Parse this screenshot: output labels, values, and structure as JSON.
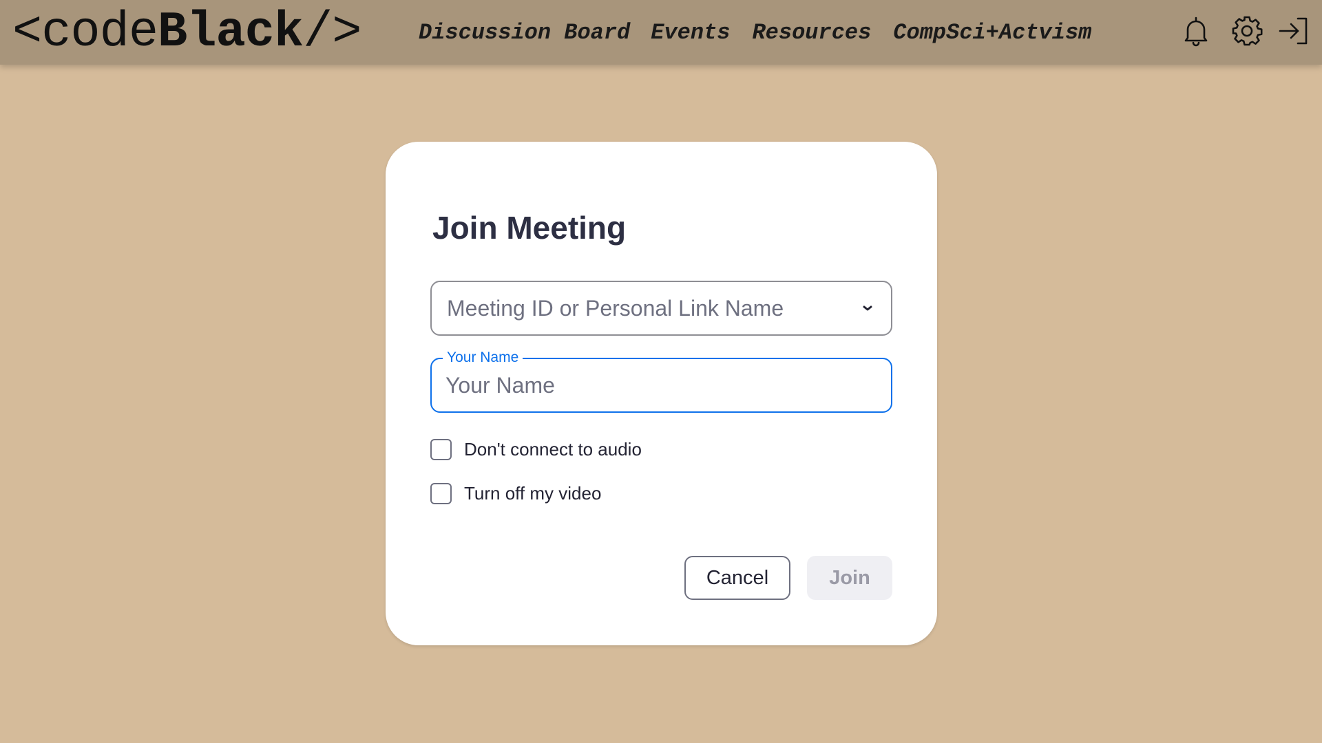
{
  "nav": {
    "logo": {
      "open": "<code",
      "bold": "Black",
      "close": "/>"
    },
    "links": [
      {
        "label": "Discussion Board"
      },
      {
        "label": "Events"
      },
      {
        "label": "Resources"
      },
      {
        "label": "CompSci+Actvism"
      }
    ],
    "icons": [
      "bell-icon",
      "gear-icon",
      "sign-in-icon"
    ]
  },
  "modal": {
    "title": "Join Meeting",
    "meeting_field": {
      "placeholder": "Meeting ID or Personal Link Name"
    },
    "name_field": {
      "label": "Your Name",
      "placeholder": "Your Name",
      "value": ""
    },
    "options": [
      {
        "label": "Don't connect to audio",
        "checked": false
      },
      {
        "label": "Turn off my video",
        "checked": false
      }
    ],
    "cancel_label": "Cancel",
    "join_label": "Join",
    "join_enabled": false
  },
  "colors": {
    "page_bg": "#d5bb9a",
    "nav_bg": "#a8957b",
    "accent": "#0e71eb",
    "title": "#2d2f43"
  }
}
